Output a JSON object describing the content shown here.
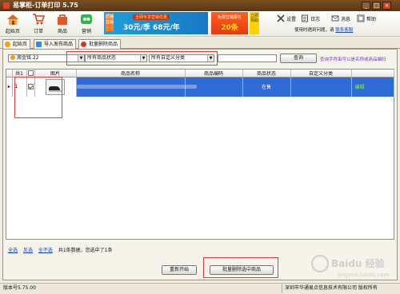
{
  "window": {
    "title": "易掌柜-订单打印 5.75",
    "min": "_",
    "max": "□",
    "close": "×"
  },
  "toolbar": {
    "items": [
      {
        "label": "起始页",
        "icon": "home-icon"
      },
      {
        "label": "订单",
        "icon": "cart-icon"
      },
      {
        "label": "商品",
        "icon": "bag-icon"
      },
      {
        "label": "营销",
        "icon": "chat-icon"
      }
    ],
    "right_items": [
      {
        "label": "设置",
        "icon": "tools-icon"
      },
      {
        "label": "日志",
        "icon": "log-icon"
      },
      {
        "label": "消息",
        "icon": "message-icon"
      },
      {
        "label": "帮助",
        "icon": "help-icon"
      }
    ],
    "help_text": "使用时遇到问题，请",
    "help_link": "联系客服",
    "ads": {
      "ad1_tag": "店铺营销",
      "ad1_top": "全网专享营销优惠",
      "ad1_big": "30元/季 68元/年",
      "ad2_top": "免费营销报名",
      "ad2_big": "20条",
      "ad3": "立即领取"
    }
  },
  "tabs": [
    {
      "label": "起始页",
      "icon": "home-icon"
    },
    {
      "label": "导入发布商品",
      "icon": "import-icon"
    },
    {
      "label": "批量删除商品",
      "icon": "delete-icon"
    }
  ],
  "filters": {
    "shop": "周金铭 22",
    "status": "所有商品状态",
    "category": "所有自定义分类",
    "search_value": "",
    "query_label": "查询",
    "tip": "查询字符串可以是名称或商品编码"
  },
  "grid": {
    "headers": [
      "共1",
      "",
      "图片",
      "商品名称",
      "商品编码",
      "商品状态",
      "自定义分类",
      ""
    ],
    "rows": [
      {
        "row_marker": "▸",
        "index": "1",
        "checked": true,
        "name": "",
        "code": "",
        "status": "在售",
        "category": "",
        "edit": "编辑"
      }
    ]
  },
  "bottom": {
    "select_all": "全选",
    "invert": "反选",
    "select_none": "全不选",
    "summary": "共1条数据，您选中了1条",
    "reset_label": "重新开始",
    "delete_label": "批量删除选中商品"
  },
  "statusbar": {
    "version": "版本号5.75.00",
    "copyright": "深圳市华通易点信息技术有限公司 版权所有"
  },
  "watermark": {
    "line1": "Baidu 经验",
    "line2": "jingyan.baidu.com"
  },
  "colors": {
    "title_bar": "#6b4119",
    "selection": "#2f6bd6",
    "highlight_box": "#e0413a",
    "link": "#1544cc"
  }
}
